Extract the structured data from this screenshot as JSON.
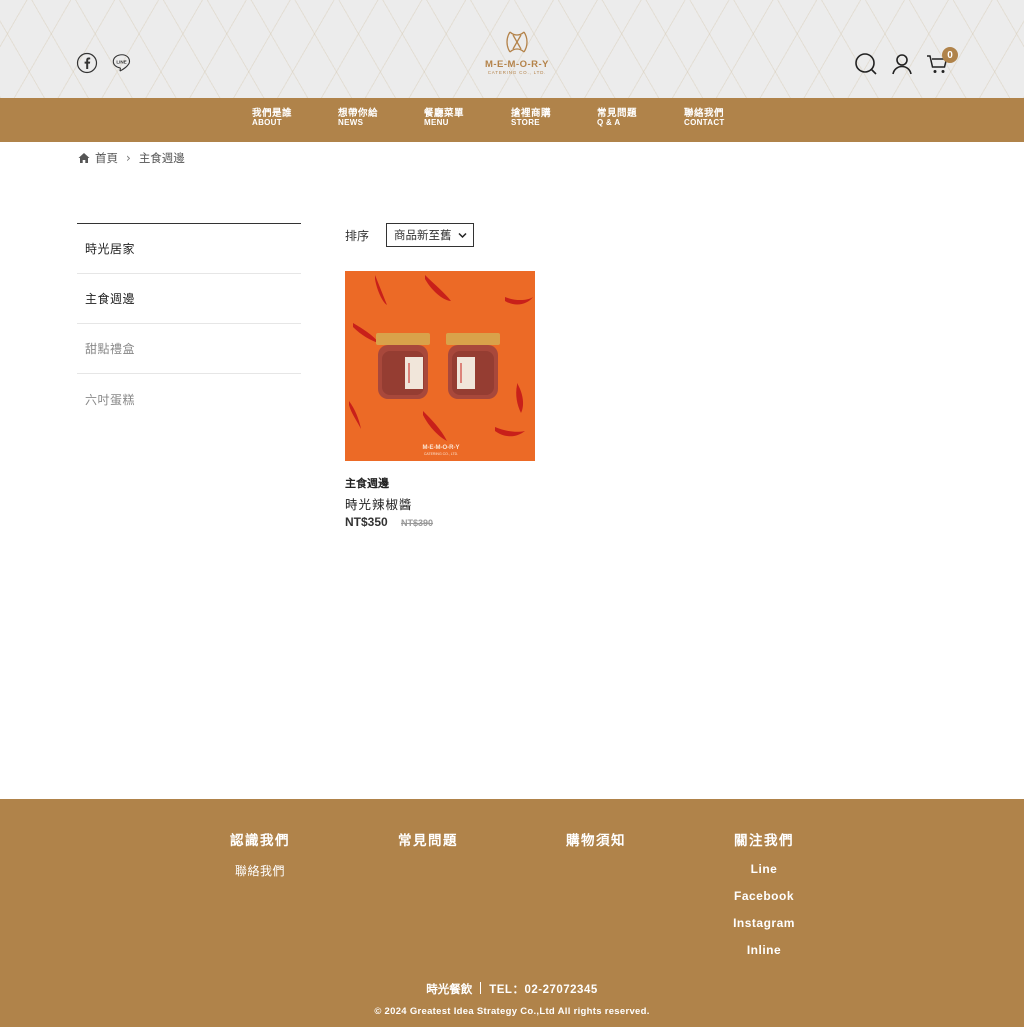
{
  "header": {
    "social": [
      "facebook-icon",
      "line-icon"
    ],
    "logo": {
      "word": "M-E-M-O-R-Y",
      "sub": "CATERING CO., LTD."
    },
    "cart_count": "0",
    "icons": [
      "search-icon",
      "user-icon",
      "cart-icon"
    ]
  },
  "nav": {
    "items": [
      {
        "zh": "我們是誰",
        "en": "ABOUT"
      },
      {
        "zh": "想帶你給",
        "en": "NEWS"
      },
      {
        "zh": "餐廳菜單",
        "en": "MENU"
      },
      {
        "zh": "搶裡商購",
        "en": "STORE"
      },
      {
        "zh": "常見問題",
        "en": "Q & A"
      },
      {
        "zh": "聯絡我們",
        "en": "CONTACT"
      }
    ]
  },
  "breadcrumb": {
    "home": "首頁",
    "current": "主食週邊"
  },
  "sidebar": {
    "items": [
      {
        "label": "時光居家"
      },
      {
        "label": "主食週邊"
      },
      {
        "label": "甜點禮盒"
      },
      {
        "label": "六吋蛋糕"
      }
    ]
  },
  "sort": {
    "label": "排序",
    "selected": "商品新至舊"
  },
  "product": {
    "category": "主食週邊",
    "name": "時光辣椒醬",
    "price": "NT$350",
    "original_price": "NT$390",
    "jar_brand": "M-E-M-O-R-Y",
    "jar_sub": "CATERING CO., LTD."
  },
  "footer": {
    "columns": [
      {
        "heading": "認識我們",
        "links": [
          "聯絡我們"
        ]
      },
      {
        "heading": "常見問題",
        "links": []
      },
      {
        "heading": "購物須知",
        "links": []
      },
      {
        "heading": "關注我們",
        "links": [
          "Line",
          "Facebook",
          "Instagram",
          "Inline"
        ]
      }
    ],
    "company": "時光餐飲",
    "tel": "TEL：02-27072345",
    "copyright": "© 2024 Greatest Idea Strategy Co.,Ltd All rights reserved."
  },
  "colors": {
    "brand": "#b0834a",
    "product_bg": "#ec6a26",
    "header_bg": "#ececec"
  }
}
